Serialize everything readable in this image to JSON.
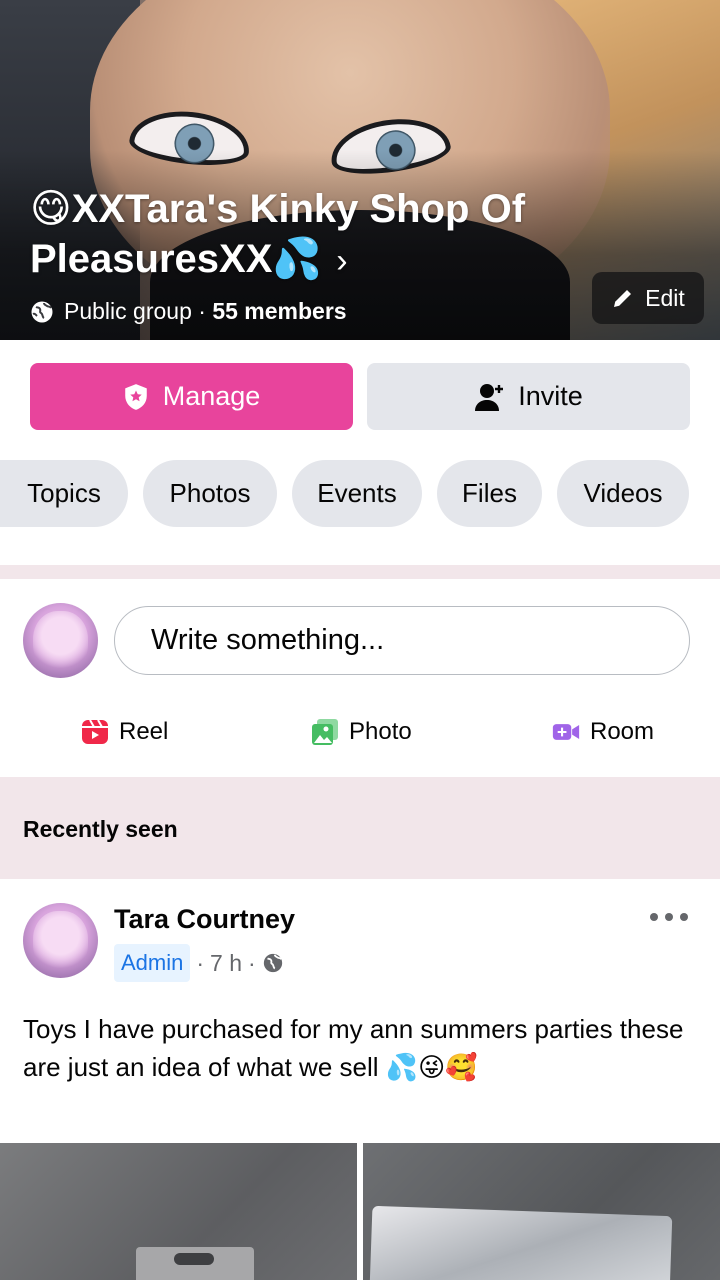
{
  "group": {
    "title": "😋XXTara's Kinky Shop Of PleasuresXX💦",
    "chevron": "›",
    "privacy": "Public group",
    "separator": " · ",
    "members": "55 members",
    "edit_label": "Edit"
  },
  "actions": {
    "manage_label": "Manage",
    "invite_label": "Invite"
  },
  "tabs": [
    {
      "label": "Topics"
    },
    {
      "label": "Photos"
    },
    {
      "label": "Events"
    },
    {
      "label": "Files"
    },
    {
      "label": "Videos"
    }
  ],
  "composer": {
    "placeholder": "Write something...",
    "quick_actions": [
      {
        "label": "Reel",
        "icon": "reel-icon",
        "color": "#f02849"
      },
      {
        "label": "Photo",
        "icon": "photo-icon",
        "color": "#45bd62"
      },
      {
        "label": "Room",
        "icon": "room-icon",
        "color": "#a064e8"
      }
    ]
  },
  "section_header": "Recently seen",
  "post": {
    "author": "Tara Courtney",
    "role": "Admin",
    "time": "7 h",
    "meta_sep": "·",
    "text": "Toys I have purchased for my ann summers parties these are just an idea of what we sell 💦😜🥰"
  },
  "colors": {
    "manage_bg": "#e8449c",
    "secondary_bg": "#e4e6eb",
    "divider_band": "#f2e6ea",
    "admin_blue": "#1b74e4"
  }
}
